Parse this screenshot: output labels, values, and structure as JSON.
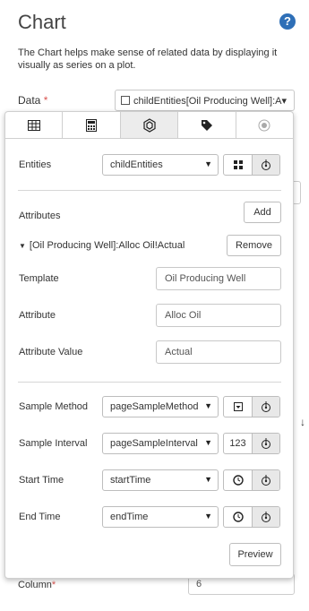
{
  "page": {
    "title": "Chart",
    "help_glyph": "?",
    "description": "The Chart helps make sense of related data by displaying it visually as series on a plot.",
    "data_label": "Data",
    "required_mark": "*",
    "data_value": "childEntities[Oil Producing Well]:A▾",
    "column_label": "Column",
    "column_value": "6"
  },
  "panel": {
    "tabs": [
      {
        "icon": "table-icon",
        "active": false
      },
      {
        "icon": "calculator-icon",
        "active": false
      },
      {
        "icon": "asset-hexagon-icon",
        "active": true
      },
      {
        "icon": "tag-icon",
        "active": false
      },
      {
        "icon": "target-icon",
        "active": false
      }
    ],
    "entities_label": "Entities",
    "entities_value": "childEntities",
    "attributes_label": "Attributes",
    "add_label": "Add",
    "attribute_item": "[Oil Producing Well]:Alloc Oil!Actual",
    "remove_label": "Remove",
    "template_label": "Template",
    "template_value": "Oil Producing Well",
    "attribute_label": "Attribute",
    "attribute_value": "Alloc Oil",
    "attribute_value_label": "Attribute Value",
    "attribute_value_value": "Actual",
    "sample_method_label": "Sample Method",
    "sample_method_value": "pageSampleMethod",
    "sample_interval_label": "Sample Interval",
    "sample_interval_value": "pageSampleInterval",
    "sample_interval_unit": "123",
    "start_time_label": "Start Time",
    "start_time_value": "startTime",
    "end_time_label": "End Time",
    "end_time_value": "endTime",
    "preview_label": "Preview"
  },
  "colors": {
    "accent": "#2e6fb7",
    "required": "#d9534f"
  }
}
